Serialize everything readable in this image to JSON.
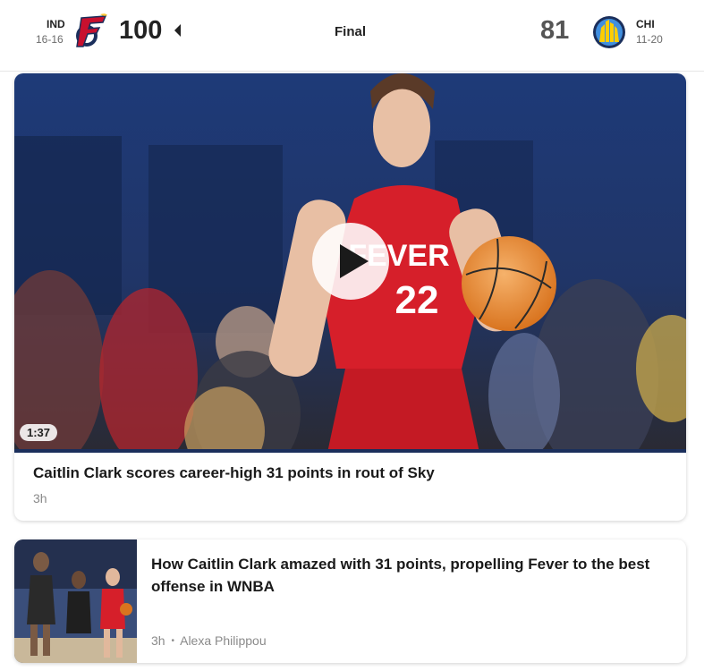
{
  "game": {
    "home": {
      "abbr": "IND",
      "record": "16-16",
      "score": "100",
      "logo_icon": "indiana-fever-logo-icon",
      "color": "#c8102e"
    },
    "away": {
      "abbr": "CHI",
      "record": "11-20",
      "score": "81",
      "logo_icon": "chicago-sky-logo-icon",
      "color": "#418fde"
    },
    "status": "Final"
  },
  "featured_video": {
    "duration": "1:37",
    "headline": "Caitlin Clark scores career-high 31 points in rout of Sky",
    "time_ago": "3h",
    "play_icon": "play-icon"
  },
  "articles": [
    {
      "headline": "How Caitlin Clark amazed with 31 points, propelling Fever to the best offense in WNBA",
      "time_ago": "3h",
      "separator": "•",
      "author": "Alexa Philippou"
    }
  ]
}
